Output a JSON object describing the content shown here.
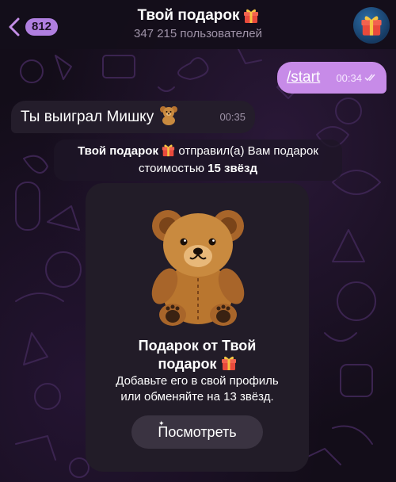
{
  "header": {
    "back_badge": "812",
    "title": "Твой подарок",
    "subtitle": "347 215 пользователей"
  },
  "messages": {
    "outgoing": {
      "text": "/start",
      "time": "00:34"
    },
    "incoming": {
      "text": "Ты выиграл Мишку",
      "time": "00:35"
    }
  },
  "service_message": {
    "sender": "Твой подарок",
    "text_part1": "отправил(а) Вам подарок",
    "text_part2": "стоимостью",
    "amount": "15 звёзд"
  },
  "gift_card": {
    "title_line1": "Подарок от Твой",
    "title_line2": "подарок",
    "description_line1": "Добавьте его в свой профиль",
    "description_line2": "или обменяйте на 13 звёзд.",
    "button_label": "Посмотреть"
  },
  "colors": {
    "outgoing_bubble": "#c78be8",
    "incoming_bubble": "#241d2b",
    "badge": "#b07fe0"
  },
  "icons": [
    "back-chevron-icon",
    "gift-icon",
    "teddy-bear-icon",
    "double-check-icon",
    "sparkle-icon"
  ]
}
